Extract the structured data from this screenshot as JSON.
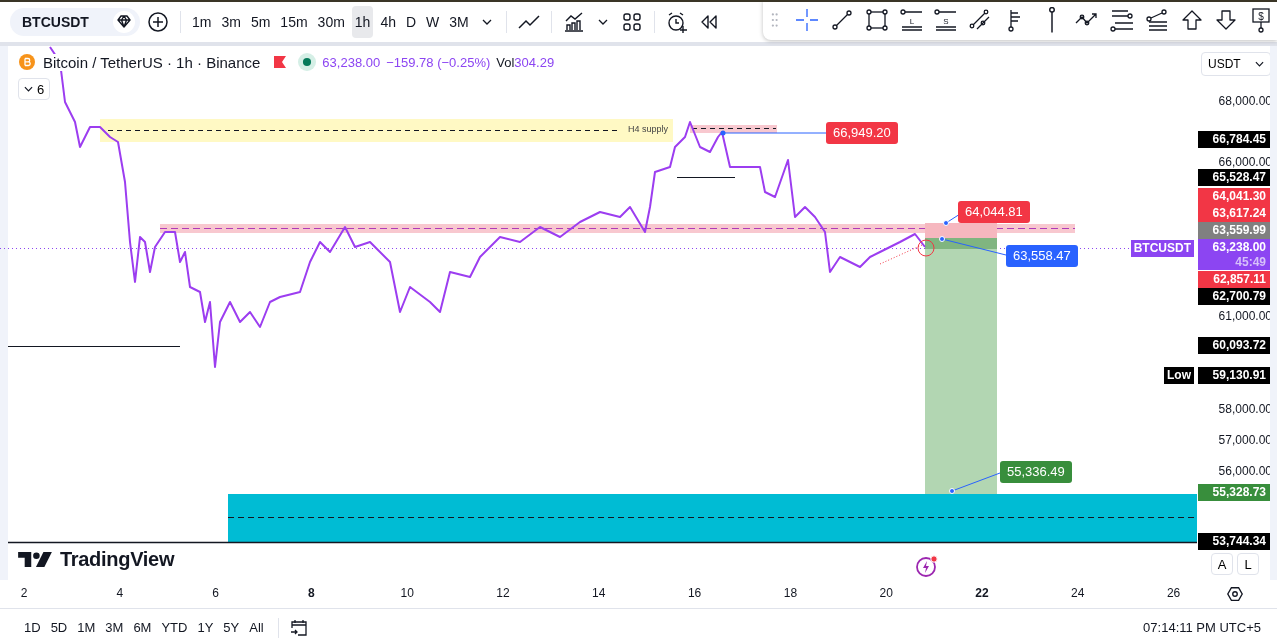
{
  "toolbar": {
    "symbol": "BTCUSDT",
    "intervals": [
      {
        "label": "1m",
        "selected": false
      },
      {
        "label": "3m",
        "selected": false
      },
      {
        "label": "5m",
        "selected": false
      },
      {
        "label": "15m",
        "selected": false
      },
      {
        "label": "30m",
        "selected": false
      },
      {
        "label": "1h",
        "selected": true
      },
      {
        "label": "4h",
        "selected": false
      },
      {
        "label": "D",
        "selected": false
      },
      {
        "label": "W",
        "selected": false
      },
      {
        "label": "3M",
        "selected": false
      }
    ],
    "drawing_tools": [
      {
        "kind": "crosshair",
        "selected": true
      },
      {
        "kind": "trend",
        "selected": false
      },
      {
        "kind": "rectangle",
        "selected": false
      },
      {
        "kind": "long",
        "label": "L",
        "selected": false
      },
      {
        "kind": "short",
        "label": "S",
        "selected": false
      },
      {
        "kind": "channel",
        "selected": false
      },
      {
        "kind": "fib",
        "selected": false
      },
      {
        "kind": "pin",
        "selected": false
      },
      {
        "kind": "path",
        "selected": false
      },
      {
        "kind": "hlines",
        "selected": false
      },
      {
        "kind": "fan",
        "selected": false
      },
      {
        "kind": "up",
        "selected": false
      },
      {
        "kind": "down",
        "selected": false
      },
      {
        "kind": "dollar",
        "label": "$",
        "selected": false
      }
    ]
  },
  "legend": {
    "title": "Bitcoin / TetherUS · 1h · Binance",
    "price": "63,238.00",
    "change": "−159.78 (−0.25%)",
    "vol_label": "Vol",
    "vol_value": "304.29",
    "indicators": "6"
  },
  "currency": "USDT",
  "chart_annotations": {
    "zone_label": "H4 supply",
    "labels": [
      {
        "text": "66,949.20",
        "color": "#f23645"
      },
      {
        "text": "64,044.81",
        "color": "#f23645"
      },
      {
        "text": "63,558.47",
        "color": "#2962ff"
      },
      {
        "text": "55,336.49",
        "color": "#388e3c"
      }
    ]
  },
  "price_axis": {
    "ticks": [
      "68,000.00",
      "66,000.00",
      "61,000.00",
      "58,000.00",
      "57,000.00",
      "56,000.00"
    ],
    "labels": [
      {
        "text": "66,784.45",
        "color": "#000000"
      },
      {
        "text": "65,528.47",
        "color": "#000000"
      },
      {
        "text": "64,041.30",
        "color": "#f23645"
      },
      {
        "text": "63,617.24",
        "color": "#f23645"
      },
      {
        "text": "63,559.99",
        "color": "#808080"
      },
      {
        "text": "63,238.00",
        "sub": "45:49",
        "tag": "BTCUSDT",
        "color": "#8c45f2"
      },
      {
        "text": "62,857.11",
        "color": "#f23645"
      },
      {
        "text": "62,700.79",
        "color": "#000000"
      },
      {
        "text": "60,093.72",
        "color": "#000000"
      },
      {
        "text": "59,130.91",
        "tag": "Low",
        "color": "#000000"
      },
      {
        "text": "55,328.73",
        "color": "#388e3c"
      },
      {
        "text": "53,744.34",
        "color": "#000000"
      }
    ]
  },
  "logo": "TradingView",
  "scale_buttons": [
    "A",
    "L"
  ],
  "time_axis": [
    {
      "label": "2",
      "bold": false
    },
    {
      "label": "4",
      "bold": false
    },
    {
      "label": "6",
      "bold": false
    },
    {
      "label": "8",
      "bold": true
    },
    {
      "label": "10",
      "bold": false
    },
    {
      "label": "12",
      "bold": false
    },
    {
      "label": "14",
      "bold": false
    },
    {
      "label": "16",
      "bold": false
    },
    {
      "label": "18",
      "bold": false
    },
    {
      "label": "20",
      "bold": false
    },
    {
      "label": "22",
      "bold": true
    },
    {
      "label": "24",
      "bold": false
    },
    {
      "label": "26",
      "bold": false
    }
  ],
  "ranges": [
    "1D",
    "5D",
    "1M",
    "3M",
    "6M",
    "YTD",
    "1Y",
    "5Y",
    "All"
  ],
  "clock": "07:14:11 PM UTC+5"
}
